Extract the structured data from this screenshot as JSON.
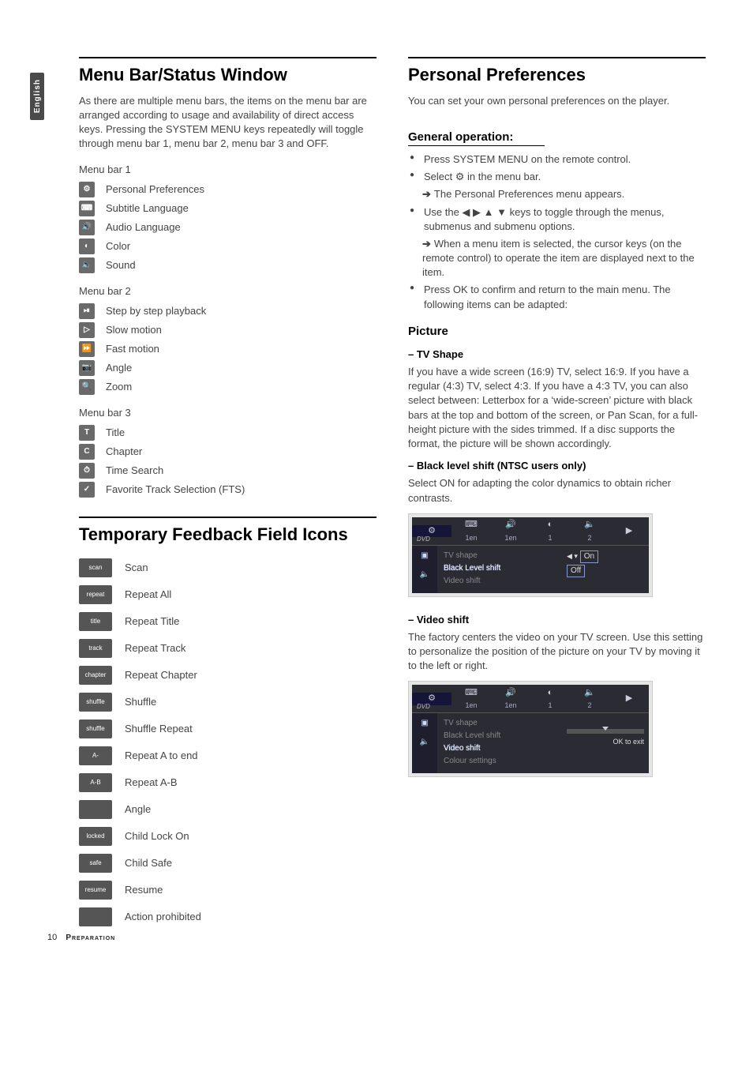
{
  "side_tab": "English",
  "left": {
    "h1": "Menu Bar/Status Window",
    "intro": "As there are multiple menu bars, the items on the menu bar are arranged according to usage and availability of direct access keys. Pressing the SYSTEM MENU keys repeatedly will toggle through menu bar 1, menu bar 2, menu bar 3 and OFF.",
    "menubars": [
      {
        "title": "Menu bar 1",
        "items": [
          {
            "glyph": "⚙",
            "label": "Personal Preferences"
          },
          {
            "glyph": "⌨",
            "label": "Subtitle Language"
          },
          {
            "glyph": "🔊",
            "label": "Audio Language"
          },
          {
            "glyph": "◐",
            "label": "Color"
          },
          {
            "glyph": "🔈",
            "label": "Sound"
          }
        ]
      },
      {
        "title": "Menu bar 2",
        "items": [
          {
            "glyph": "⏯",
            "label": "Step by step playback"
          },
          {
            "glyph": "▷",
            "label": "Slow motion"
          },
          {
            "glyph": "⏩",
            "label": "Fast motion"
          },
          {
            "glyph": "📷",
            "label": "Angle"
          },
          {
            "glyph": "🔍",
            "label": "Zoom"
          }
        ]
      },
      {
        "title": "Menu bar 3",
        "items": [
          {
            "glyph": "T",
            "label": "Title"
          },
          {
            "glyph": "C",
            "label": "Chapter"
          },
          {
            "glyph": "⏱",
            "label": "Time Search"
          },
          {
            "glyph": "✓",
            "label": "Favorite Track Selection (FTS)"
          }
        ]
      }
    ],
    "h1b": "Temporary Feedback Field Icons",
    "feedback": [
      {
        "top": "scan",
        "label": "Scan"
      },
      {
        "top": "repeat",
        "label": "Repeat All"
      },
      {
        "top": "title",
        "label": "Repeat Title"
      },
      {
        "top": "track",
        "label": "Repeat Track"
      },
      {
        "top": "chapter",
        "label": "Repeat Chapter"
      },
      {
        "top": "shuffle",
        "label": "Shuffle"
      },
      {
        "top": "shuffle",
        "label": "Shuffle Repeat"
      },
      {
        "top": "A-",
        "label": "Repeat A to end"
      },
      {
        "top": "A-B",
        "label": "Repeat A-B"
      },
      {
        "top": "",
        "label": "Angle"
      },
      {
        "top": "locked",
        "label": "Child Lock On"
      },
      {
        "top": "safe",
        "label": "Child Safe"
      },
      {
        "top": "resume",
        "label": "Resume"
      },
      {
        "top": "",
        "label": "Action prohibited"
      }
    ]
  },
  "right": {
    "h1": "Personal Preferences",
    "intro": "You can set your own personal preferences on the player.",
    "general_h": "General operation:",
    "general_items": [
      "Press SYSTEM MENU on the remote control.",
      "Select ⚙ in the menu bar."
    ],
    "general_arrow1": "The Personal Preferences menu appears.",
    "general_item3": "Use the ◀ ▶ ▲ ▼ keys to toggle through the menus, submenus and submenu options.",
    "general_arrow2": "When a menu item is selected, the cursor keys (on the remote control) to operate the item are displayed next to the item.",
    "general_item4": "Press OK to confirm and return to the main menu. The following items can be adapted:",
    "picture_h": "Picture",
    "tvshape_h": "–  TV Shape",
    "tvshape_p": "If you have a wide screen (16:9) TV, select 16:9. If you have a regular (4:3) TV, select 4:3. If you have a 4:3 TV, you can also select between: Letterbox for a ‘wide-screen’ picture with black bars at the top and bottom of the screen, or Pan Scan, for a full-height picture with the sides trimmed. If a disc supports the format, the picture will be shown accordingly.",
    "black_h": "–  Black level shift (NTSC users only)",
    "black_p": "Select ON for adapting the color dynamics to obtain richer contrasts.",
    "osd1": {
      "top": [
        "",
        "1en",
        "1en",
        "1",
        "2"
      ],
      "menu": [
        "TV shape",
        "Black Level shift",
        "Video shift"
      ],
      "highlight_index": 1,
      "vals": [
        "On",
        "Off"
      ]
    },
    "videoshift_h": "–  Video shift",
    "videoshift_p": "The factory centers the video on your TV screen. Use this setting to personalize the position of the picture on your TV by moving it to the left or right.",
    "osd2": {
      "top": [
        "",
        "1en",
        "1en",
        "1",
        "2"
      ],
      "menu": [
        "TV shape",
        "Black Level shift",
        "Video shift",
        "Colour settings"
      ],
      "highlight_index": 2,
      "slider_label": "OK to exit"
    }
  },
  "footer": {
    "page": "10",
    "section": "Preparation"
  }
}
